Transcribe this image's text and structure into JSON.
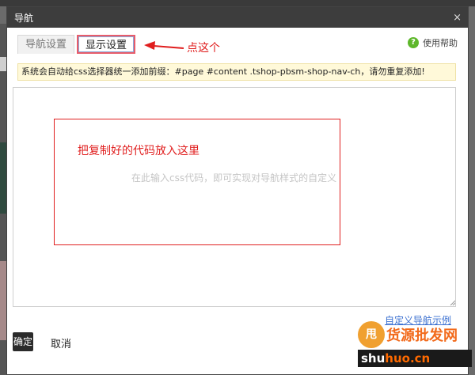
{
  "dialog": {
    "title": "导航",
    "close_glyph": "×"
  },
  "tabs": [
    {
      "label": "导航设置",
      "active": false
    },
    {
      "label": "显示设置",
      "active": true
    }
  ],
  "annotations": {
    "click_hint": "点这个",
    "paste_hint": "把复制好的代码放入这里"
  },
  "help": {
    "label": "使用帮助",
    "icon_glyph": "?"
  },
  "notice": "系统会自动给css选择器统一添加前缀：#page #content .tshop-pbsm-shop-nav-ch，请勿重复添加!",
  "css_input": {
    "value": "",
    "placeholder": "在此输入css代码，即可实现对导航样式的自定义"
  },
  "example_link": "自定义导航示例",
  "buttons": {
    "ok": "确定",
    "cancel": "取消"
  },
  "watermark": {
    "badge": "甩",
    "cn": "货源批发网",
    "en_left": "shu",
    "en_right": "huo.cn"
  },
  "colors": {
    "annotation_red": "#e01e1e",
    "titlebar": "#3d3d3d",
    "help_green": "#5db72a",
    "notice_bg": "#fff9d9",
    "link_blue": "#3a6fd0"
  }
}
